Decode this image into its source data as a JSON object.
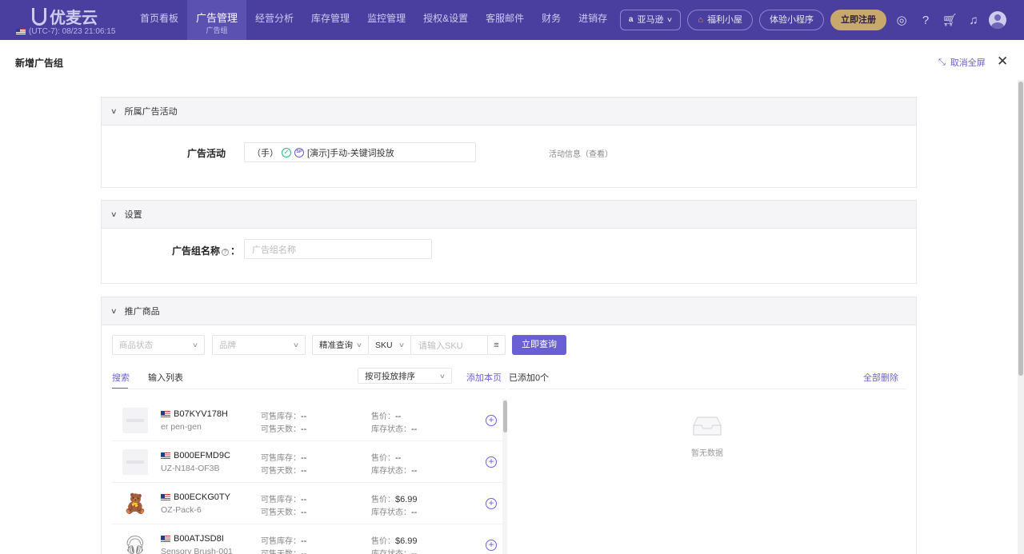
{
  "topbar": {
    "logo_text": "优麦云",
    "timezone": "(UTC-7): 08/23 21:06:15",
    "nav": [
      {
        "label": "首页看板"
      },
      {
        "label": "广告管理",
        "sub": "广告组",
        "active": true
      },
      {
        "label": "经营分析"
      },
      {
        "label": "库存管理"
      },
      {
        "label": "监控管理"
      },
      {
        "label": "授权&设置"
      },
      {
        "label": "客服邮件"
      },
      {
        "label": "财务"
      },
      {
        "label": "进销存"
      }
    ],
    "store_label": "亚马逊",
    "welfare_label": "福利小屋",
    "miniprogram_label": "体验小程序",
    "register_label": "立即注册",
    "accent_color": "#4a3f9f"
  },
  "drawer": {
    "title": "新增广告组",
    "cancel_fullscreen": "取消全屏"
  },
  "section_campaign": {
    "title": "所属广告活动",
    "field_label": "广告活动",
    "campaign_prefix": "（手）",
    "campaign_name": "[演示]手动-关键词投放",
    "campaign_badge_icon": "check-circle-icon",
    "campaign_type_badge": "SP",
    "info_text": "活动信息（查看）"
  },
  "section_settings": {
    "title": "设置",
    "name_label": "广告组名称",
    "name_colon": "：",
    "name_placeholder": "广告组名称"
  },
  "section_products": {
    "title": "推广商品",
    "filters": {
      "status_placeholder": "商品状态",
      "brand_placeholder": "品牌",
      "query_mode": "精准查询",
      "field": "SKU",
      "sku_placeholder": "请输入SKU",
      "search_button": "立即查询"
    },
    "tabs": [
      "搜索",
      "输入列表"
    ],
    "sort_select": "按可投放排序",
    "add_page": "添加本页",
    "added_count": "已添加0个",
    "delete_all": "全部删除",
    "empty_text": "暂无数据",
    "labels": {
      "stock": "可售库存：",
      "days": "可售天数：",
      "price": "售价：",
      "stock_status": "库存状态："
    },
    "products": [
      {
        "asin": "B07KYV178H",
        "sku": "er pen-gen",
        "stock": "--",
        "days": "--",
        "price": "--",
        "stock_status": "--",
        "thumb": "placeholder"
      },
      {
        "asin": "B000EFMD9C",
        "sku": "UZ-N184-OF3B",
        "stock": "--",
        "days": "--",
        "price": "--",
        "stock_status": "--",
        "thumb": "placeholder"
      },
      {
        "asin": "B00ECKG0TY",
        "sku": "OZ-Pack-6",
        "stock": "--",
        "days": "--",
        "price": "$6.99",
        "stock_status": "--",
        "thumb": "teddy-bear"
      },
      {
        "asin": "B00ATJSD8I",
        "sku": "Sensory Brush-001",
        "stock": "--",
        "days": "--",
        "price": "$6.99",
        "stock_status": "--",
        "thumb": "headphones"
      }
    ]
  }
}
